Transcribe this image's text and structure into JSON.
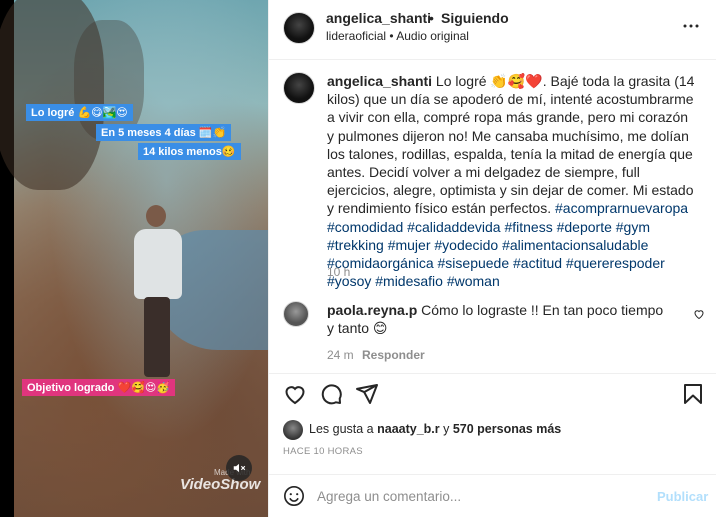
{
  "post": {
    "username": "angelica_shanti",
    "separator": "•",
    "follow_status": "Siguiendo",
    "audio": "lideraoficial • Audio original"
  },
  "video": {
    "label_1": "Lo logré 💪😋🏞️😍",
    "label_2": "En 5 meses 4 días 🗓️👏",
    "label_3": "14 kilos menos🥴",
    "label_4": "Objetivo logrado ❤️🥰😍🥳",
    "watermark": "VideoShow",
    "watermark_small": "Made with"
  },
  "caption": {
    "username": "angelica_shanti",
    "text": " Lo logré 👏🥰❤️. Bajé toda la grasita (14 kilos) que un día se apoderó de mí, intenté acostumbrarme a vivir con ella, compré ropa más grande, pero mi corazón y pulmones dijeron no! Me cansaba muchísimo, me dolían los talones, rodillas, espalda, tenía la mitad de energía que antes. Decidí volver a mi delgadez de siempre, full ejercicios, alegre, optimista y sin dejar de comer. Mi estado y rendimiento físico están perfectos. ",
    "hashtags": "#acomprarnuevaropa #comodidad #calidaddevida #fitness #deporte #gym #trekking #mujer #yodecido #alimentacionsaludable #comidaorgánica #sisepuede #actitud #quererespoder #yosoy #midesafio #woman",
    "time": "10 h"
  },
  "comment": {
    "username": "paola.reyna.p",
    "text": " Cómo lo lograste !! En tan poco tiempo y tanto 😊",
    "time": "24 m",
    "reply": "Responder"
  },
  "likes": {
    "prefix": "Les gusta a ",
    "user": "naaaty_b.r",
    "middle": " y ",
    "count": "570 personas más"
  },
  "time_ago": "HACE 10 HORAS",
  "composer": {
    "placeholder": "Agrega un comentario...",
    "post_label": "Publicar"
  },
  "icons": [
    "more-icon",
    "heart-icon",
    "comment-icon",
    "share-icon",
    "bookmark-icon",
    "emoji-icon",
    "mute-icon"
  ]
}
